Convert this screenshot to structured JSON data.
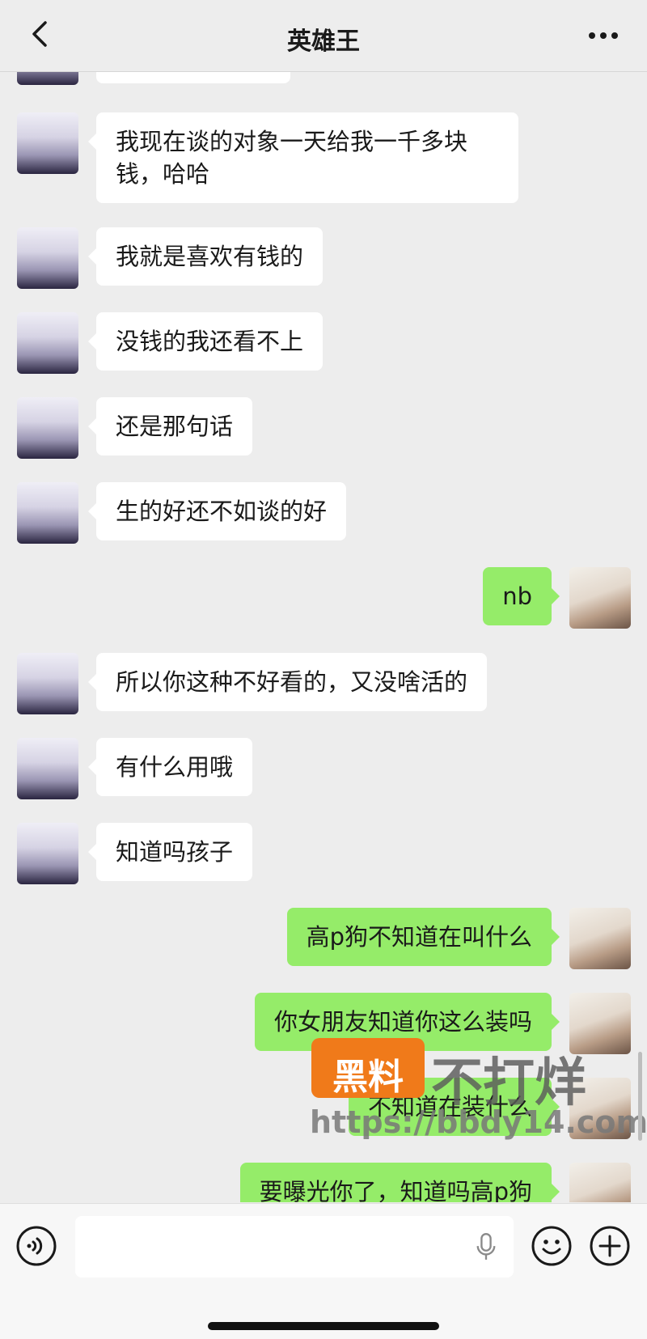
{
  "header": {
    "title": "英雄王"
  },
  "messages": [
    {
      "side": "left",
      "lines": [
        "我现在谈的对象一天给我一千多块",
        "钱，哈哈"
      ]
    },
    {
      "side": "left",
      "lines": [
        "我就是喜欢有钱的"
      ]
    },
    {
      "side": "left",
      "lines": [
        "没钱的我还看不上"
      ]
    },
    {
      "side": "left",
      "lines": [
        "还是那句话"
      ]
    },
    {
      "side": "left",
      "lines": [
        "生的好还不如谈的好"
      ]
    },
    {
      "side": "right",
      "lines": [
        "nb"
      ]
    },
    {
      "side": "left",
      "lines": [
        "所以你这种不好看的，又没啥活的"
      ]
    },
    {
      "side": "left",
      "lines": [
        "有什么用哦"
      ]
    },
    {
      "side": "left",
      "lines": [
        "知道吗孩子"
      ]
    },
    {
      "side": "right",
      "lines": [
        "高p狗不知道在叫什么"
      ]
    },
    {
      "side": "right",
      "lines": [
        "你女朋友知道你这么装吗"
      ]
    },
    {
      "side": "right",
      "lines": [
        "不知道在装什么"
      ]
    },
    {
      "side": "right",
      "lines": [
        "要曝光你了，知道吗高p狗"
      ]
    }
  ],
  "watermark": {
    "badge": "黑料",
    "brand": "不打烊",
    "url": "https://bbdy14.com"
  },
  "colors": {
    "sent_bubble": "#95ec69",
    "received_bubble": "#ffffff",
    "background": "#ededed"
  }
}
